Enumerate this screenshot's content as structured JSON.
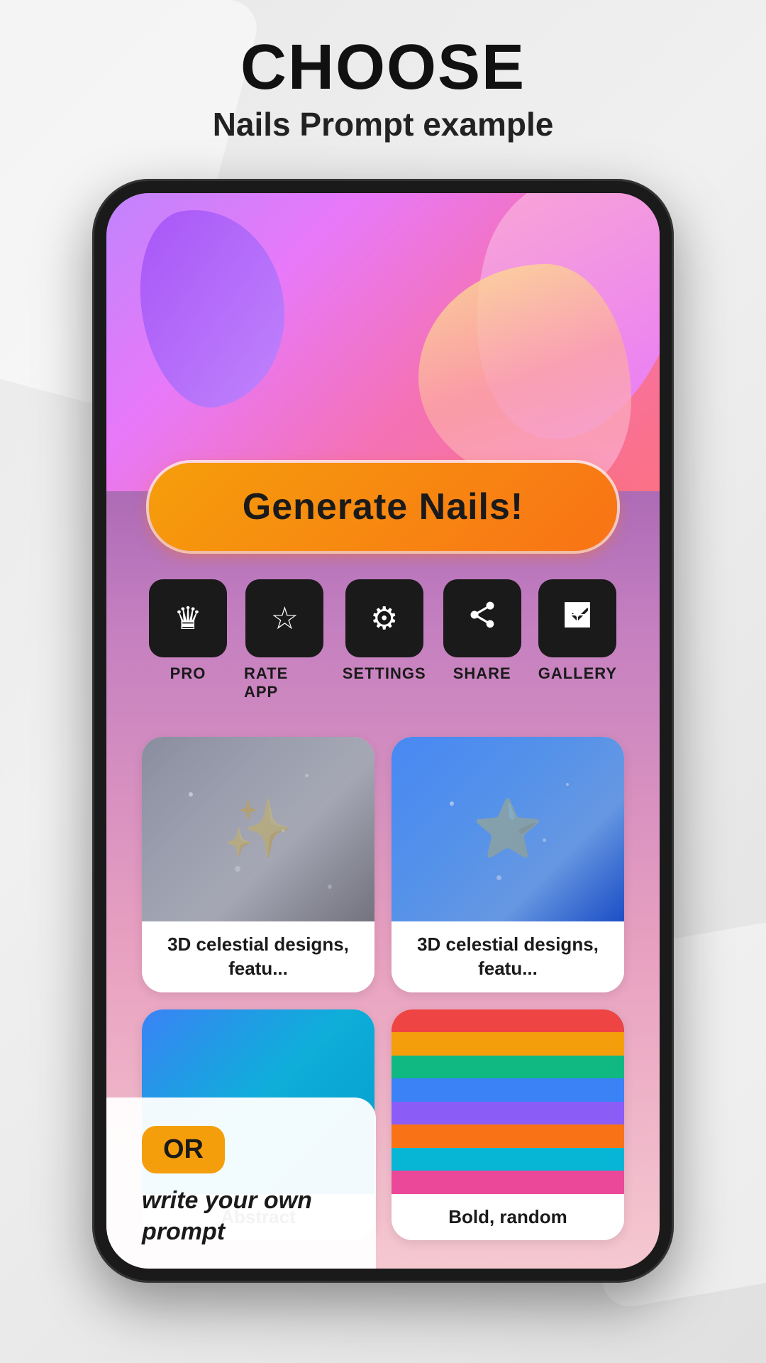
{
  "header": {
    "main_title": "CHOOSE",
    "subtitle": "Nails Prompt example"
  },
  "generate_button": {
    "label": "Generate Nails!"
  },
  "action_icons": [
    {
      "id": "pro",
      "label": "PRO",
      "icon": "♛"
    },
    {
      "id": "rate_app",
      "label": "RATE APP",
      "icon": "☆"
    },
    {
      "id": "settings",
      "label": "SETTINGS",
      "icon": "⚙"
    },
    {
      "id": "share",
      "label": "SHARE",
      "icon": "◁"
    },
    {
      "id": "gallery",
      "label": "GALLERY",
      "icon": "▦"
    }
  ],
  "nail_cards": [
    {
      "id": "card1",
      "label": "3D celestial designs, featu...",
      "image_type": "silver-glitter"
    },
    {
      "id": "card2",
      "label": "3D celestial designs, featu...",
      "image_type": "blue-glitter"
    },
    {
      "id": "card3",
      "label": "Abstract",
      "image_type": "blue-teal"
    },
    {
      "id": "card4",
      "label": "Bold, random",
      "image_type": "colorful-stripes"
    }
  ],
  "or_prompt": {
    "or_label": "OR",
    "prompt_text": "write your own prompt"
  },
  "colors": {
    "generate_btn_gradient_start": "#f59e0b",
    "generate_btn_gradient_end": "#f97316",
    "background": "#e8e8e8",
    "phone_bg": "#1a1a1a",
    "or_badge_color": "#f59e0b"
  }
}
